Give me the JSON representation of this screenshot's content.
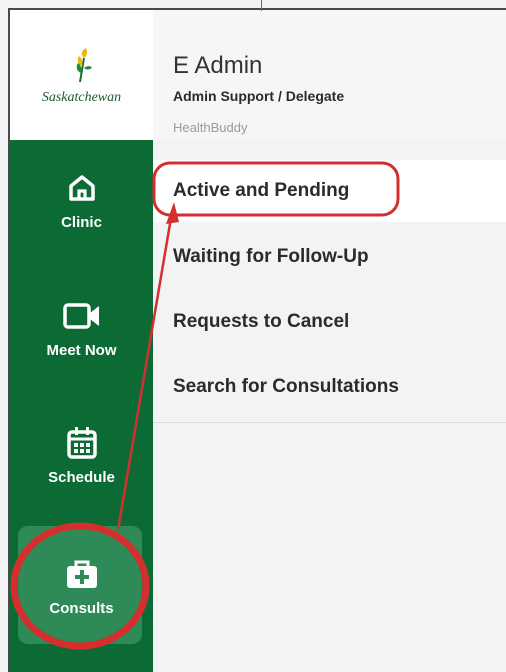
{
  "brand": {
    "logo_text": "Saskatchewan",
    "green": "#0c6b35"
  },
  "sidebar": {
    "items": [
      {
        "label": "Clinic",
        "icon": "home-icon"
      },
      {
        "label": "Meet Now",
        "icon": "video-camera-icon"
      },
      {
        "label": "Schedule",
        "icon": "calendar-icon"
      },
      {
        "label": "Consults",
        "icon": "medical-kit-icon",
        "active": true
      }
    ]
  },
  "header": {
    "user_name": "E Admin",
    "user_role": "Admin Support / Delegate",
    "app_name": "HealthBuddy"
  },
  "menu": {
    "items": [
      {
        "label": "Active and Pending",
        "selected": true
      },
      {
        "label": "Waiting for Follow-Up"
      },
      {
        "label": "Requests to Cancel"
      },
      {
        "label": "Search for Consultations"
      }
    ]
  },
  "annotation": {
    "color": "#d32f2f",
    "kind": "circle-and-arrow-highlight"
  }
}
